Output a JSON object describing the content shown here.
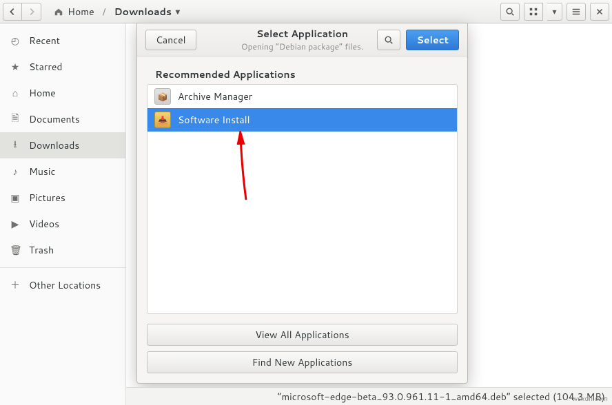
{
  "toolbar": {
    "path": {
      "home": "Home",
      "current": "Downloads"
    }
  },
  "sidebar": {
    "items": [
      {
        "label": "Recent",
        "icon": "clock-icon"
      },
      {
        "label": "Starred",
        "icon": "star-icon"
      },
      {
        "label": "Home",
        "icon": "home-icon"
      },
      {
        "label": "Documents",
        "icon": "document-icon"
      },
      {
        "label": "Downloads",
        "icon": "download-icon"
      },
      {
        "label": "Music",
        "icon": "music-icon"
      },
      {
        "label": "Pictures",
        "icon": "picture-icon"
      },
      {
        "label": "Videos",
        "icon": "video-icon"
      },
      {
        "label": "Trash",
        "icon": "trash-icon"
      }
    ],
    "other": "Other Locations"
  },
  "dialog": {
    "title": "Select Application",
    "subtitle": "Opening “Debian package” files.",
    "cancel": "Cancel",
    "select": "Select",
    "recommended": "Recommended Applications",
    "apps": [
      {
        "name": "Archive Manager"
      },
      {
        "name": "Software Install"
      }
    ],
    "view_all": "View All Applications",
    "find_new": "Find New Applications"
  },
  "status": {
    "text": "“microsoft-edge-beta_93.0.961.11-1_amd64.deb” selected (104.3 MB)"
  },
  "watermark": "wsxdn.com"
}
